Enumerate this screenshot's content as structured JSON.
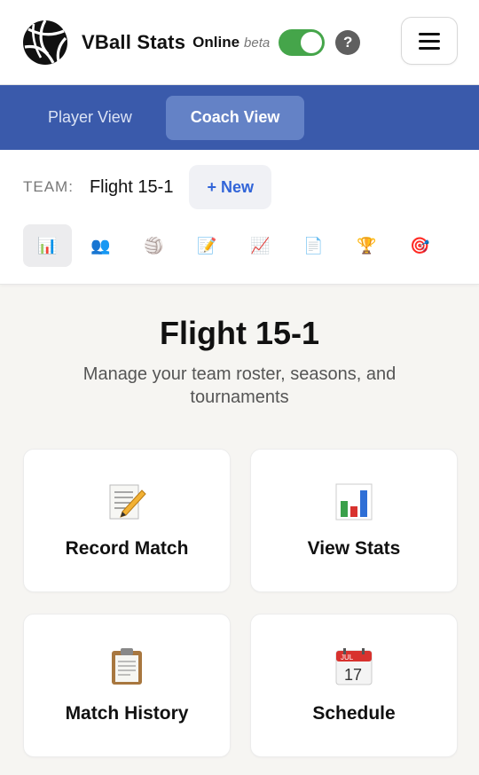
{
  "header": {
    "brand": "VBall Stats",
    "status": "Online",
    "beta": "beta",
    "help": "?",
    "toggle_on": true,
    "accent_color": "#45a54a"
  },
  "view_switch": {
    "tabs": [
      {
        "label": "Player View",
        "active": false
      },
      {
        "label": "Coach View",
        "active": true
      }
    ],
    "bar_color": "#3a5aab"
  },
  "team": {
    "label": "TEAM:",
    "name": "Flight 15-1",
    "new_button": "+ New"
  },
  "nav_icons": [
    {
      "name": "bar-chart-icon",
      "glyph": "📊",
      "active": true
    },
    {
      "name": "people-icon",
      "glyph": "👥",
      "active": false
    },
    {
      "name": "volleyball-icon",
      "glyph": "🏐",
      "active": false
    },
    {
      "name": "memo-icon",
      "glyph": "📝",
      "active": false
    },
    {
      "name": "trend-chart-icon",
      "glyph": "📈",
      "active": false
    },
    {
      "name": "document-icon",
      "glyph": "📄",
      "active": false
    },
    {
      "name": "trophy-icon",
      "glyph": "🏆",
      "active": false
    },
    {
      "name": "target-icon",
      "glyph": "🎯",
      "active": false
    }
  ],
  "main": {
    "title": "Flight 15-1",
    "subtitle": "Manage your team roster, seasons, and tournaments",
    "cards": [
      {
        "label": "Record Match",
        "icon": "memo-icon"
      },
      {
        "label": "View Stats",
        "icon": "bar-chart-icon"
      },
      {
        "label": "Match History",
        "icon": "clipboard-icon"
      },
      {
        "label": "Schedule",
        "icon": "calendar-icon",
        "calendar_month": "JUL",
        "calendar_day": "17"
      }
    ]
  }
}
